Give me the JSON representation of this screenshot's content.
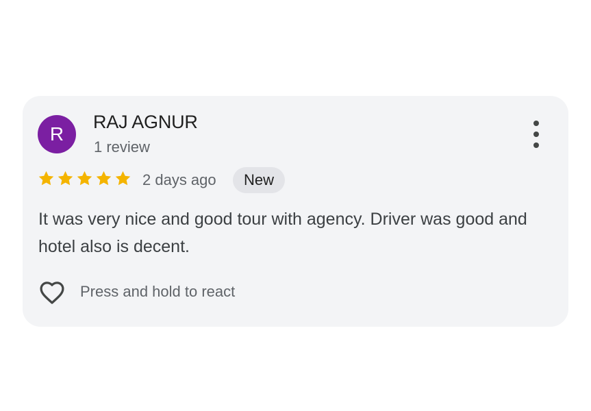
{
  "review": {
    "avatar_letter": "R",
    "avatar_color": "#7b1fa2",
    "author": "RAJ AGNUR",
    "author_reviews": "1 review",
    "rating": 5,
    "max_rating": 5,
    "star_color": "#f4b400",
    "time_ago": "2 days ago",
    "badge": "New",
    "text": "It was very nice and good tour with agency. Driver was good and hotel also is decent.",
    "react_label": "Press and hold to react",
    "icons": {
      "more": "more-vert-icon",
      "react": "heart-outline-icon",
      "star": "star-icon"
    }
  }
}
